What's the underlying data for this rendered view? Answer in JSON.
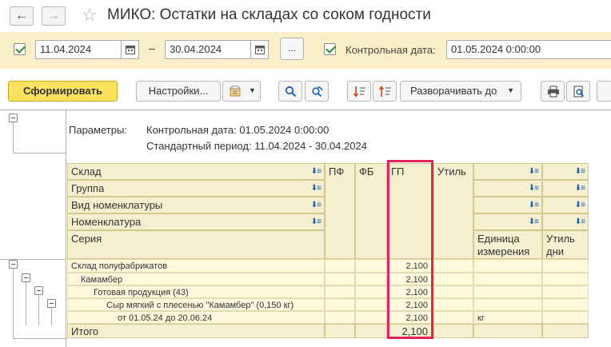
{
  "window": {
    "title": "МИКО: Остатки на складах со соком годности"
  },
  "params": {
    "date_from": "11.04.2024",
    "date_to": "30.04.2024",
    "dash": "–",
    "dots_label": "...",
    "control_date_label": "Контрольная дата:",
    "control_date_value": "01.05.2024  0:00:00"
  },
  "toolbar": {
    "generate_label": "Сформировать",
    "settings_label": "Настройки...",
    "expand_label": "Разворачивать до"
  },
  "report": {
    "params_label": "Параметры:",
    "param_line1": "Контрольная дата: 01.05.2024 0:00:00",
    "param_line2": "Стандартный период: 11.04.2024 - 30.04.2024",
    "headers": {
      "warehouse": "Склад",
      "group": "Группа",
      "nomenclature_type": "Вид номенклатуры",
      "nomenclature": "Номенклатура",
      "series": "Серия",
      "pf": "ПФ",
      "fb": "ФБ",
      "gp": "ГП",
      "util": "Утиль",
      "unit": "Единица измерения",
      "util_days": "Утиль дни"
    },
    "rows": [
      {
        "name": "Склад полуфабрикатов",
        "gp": "2,100",
        "unit": ""
      },
      {
        "name": "Камамбер",
        "gp": "2,100",
        "unit": ""
      },
      {
        "name": "Готовая продукция (43)",
        "gp": "2,100",
        "unit": ""
      },
      {
        "name": "Сыр мягкий с плесенью \"Камамбер\" (0,150 кг)",
        "gp": "2,100",
        "unit": ""
      },
      {
        "name": "от 01.05.24 до 20.06.24",
        "gp": "2,100",
        "unit": "кг"
      }
    ],
    "total": {
      "label": "Итого",
      "gp": "2,100"
    }
  }
}
